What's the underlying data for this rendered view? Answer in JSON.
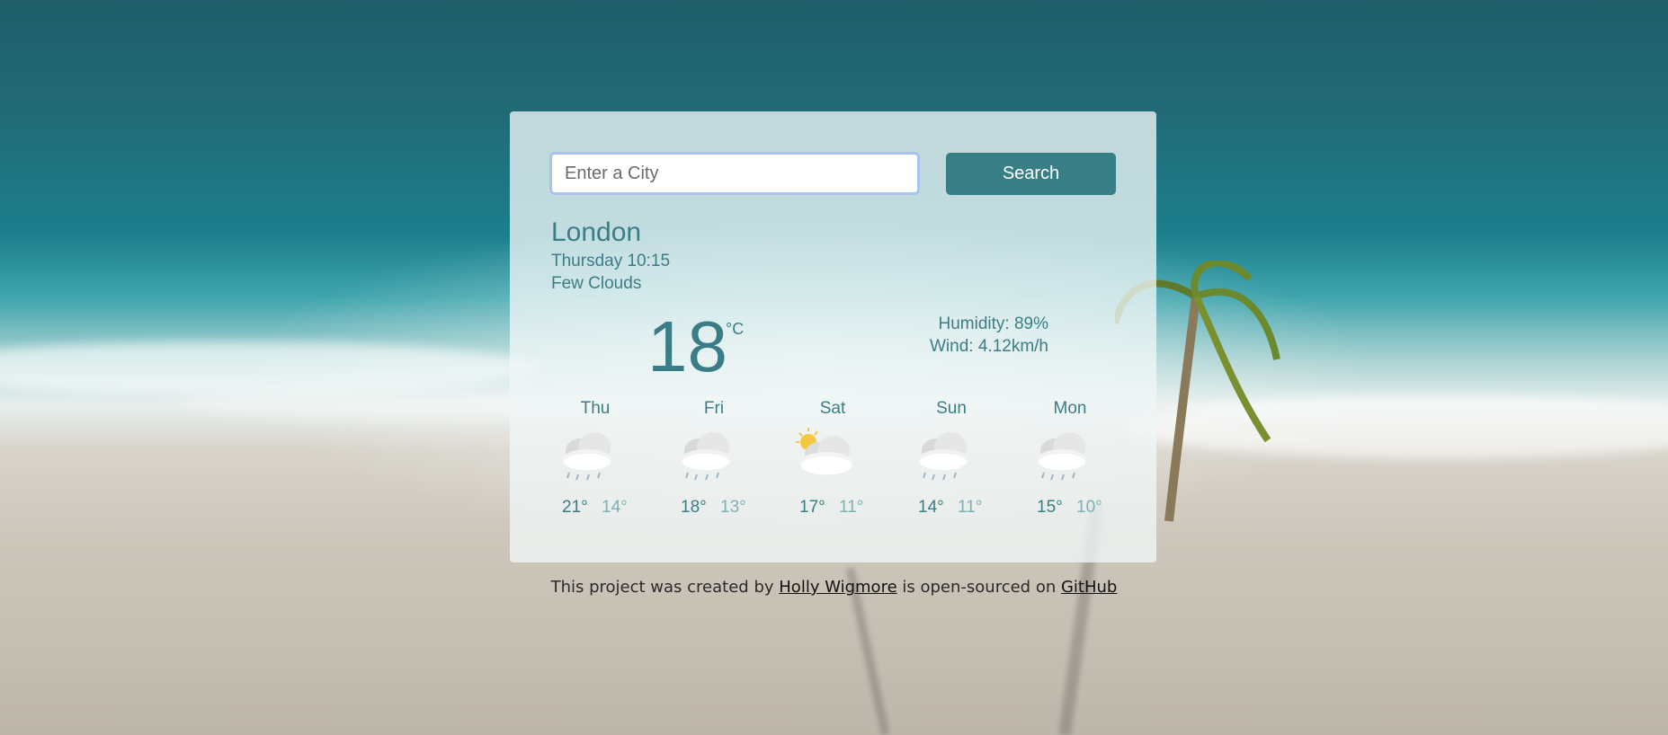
{
  "search": {
    "placeholder": "Enter a City",
    "button_label": "Search"
  },
  "current": {
    "city": "London",
    "datetime": "Thursday 10:15",
    "description": "Few Clouds",
    "temperature": "18",
    "unit": "°C",
    "humidity": "Humidity: 89%",
    "wind": "Wind: 4.12km/h"
  },
  "forecast": [
    {
      "day": "Thu",
      "high": "21°",
      "low": "14°",
      "icon": "rain-cloud-icon"
    },
    {
      "day": "Fri",
      "high": "18°",
      "low": "13°",
      "icon": "rain-cloud-icon"
    },
    {
      "day": "Sat",
      "high": "17°",
      "low": "11°",
      "icon": "sun-cloud-icon"
    },
    {
      "day": "Sun",
      "high": "14°",
      "low": "11°",
      "icon": "rain-cloud-icon"
    },
    {
      "day": "Mon",
      "high": "15°",
      "low": "10°",
      "icon": "rain-cloud-icon"
    }
  ],
  "footer": {
    "prefix": "This project was created by",
    "author_link": "Holly Wigmore",
    "middle": "is open-sourced on",
    "repo_link": "GitHub"
  },
  "colors": {
    "accent": "#377f85",
    "text": "#3b7d86",
    "low_temp": "#7fb0b3"
  }
}
